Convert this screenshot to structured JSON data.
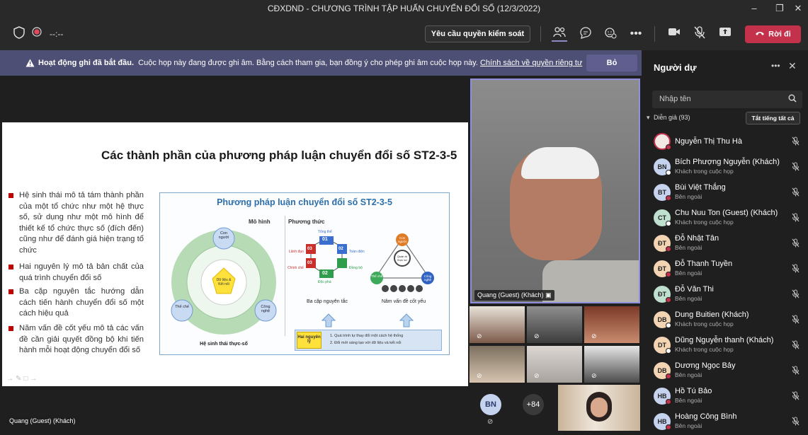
{
  "window": {
    "title": "CĐXDND - CHƯƠNG TRÌNH TẬP HUẤN CHUYỂN ĐỔI SỐ (12/3/2022)",
    "minimize_icon": "minimize-icon",
    "restore_icon": "restore-icon",
    "close_icon": "close-icon"
  },
  "toolbar": {
    "timer": "--:--",
    "request_control_label": "Yêu cầu quyền kiểm soát",
    "leave_label": "Rời đi"
  },
  "banner": {
    "bold": "Hoạt động ghi đã bắt đầu.",
    "message": "Cuộc họp này đang được ghi âm. Bằng cách tham gia, bạn đồng ý cho phép ghi âm cuộc họp này.",
    "link": "Chính sách về quyền riêng tư",
    "dismiss_label": "Bỏ"
  },
  "slide": {
    "title": "Các thành phần của phương pháp luận chuyển đổi số ST2-3-5",
    "bullets": [
      "Hệ sinh thái mô tả tám thành phần của một tổ chức như một hệ thực số, sử dụng như một mô hình để thiết kế tổ chức thực số (đích đến) cũng như để đánh giá hiện trạng tổ chức",
      "Hai nguyên lý mô tả bản chất của quá trình chuyển đổi số",
      "Ba cặp nguyên tắc hướng dẫn cách tiến hành chuyển đổi số một cách hiệu quả",
      "Năm vấn đề cốt yếu mô tả các vấn đề cần giải quyết đồng bộ khi tiến hành mỗi hoạt động chuyển đổi số"
    ],
    "diagram": {
      "title": "Phương pháp luận chuyển đổi số ST2-3-5",
      "col_model": "Mô hình",
      "col_method": "Phương thức",
      "ecosystem_label": "Hệ sinh thái thực-số",
      "center_label": "Dữ liệu & Kết nối",
      "node_top": "Con người",
      "node_left": "Thể chế",
      "node_right": "Công nghệ",
      "hex_numbers": [
        "01",
        "02",
        "02",
        "03",
        "03"
      ],
      "hex_labels": [
        "Tổng thể",
        "Toàn diện",
        "Đồng bộ",
        "Độc phá",
        "Chính chế",
        "Lãnh đạo"
      ],
      "pairs_label": "Ba cặp nguyên tắc",
      "tri_center": "Quản trị thực số",
      "tri_top": "Con người",
      "tri_left": "Thể chế",
      "tri_right": "Công nghệ",
      "issues_label": "Năm vấn đề cốt yếu",
      "principle_box": "Hai nguyên lý",
      "principles": [
        "1.   Quá trình tự thay đổi một cách hệ thống",
        "2.   Đổi mới sáng tạo với dữ liệu và kết nối"
      ]
    }
  },
  "speaker": {
    "name": "Quang (Guest) (Khách)"
  },
  "presenter_label": "Quang (Guest) (Khách)",
  "stage_avatar": {
    "initials": "BN",
    "overflow": "+84"
  },
  "panel": {
    "title": "Người dự",
    "search_placeholder": "Nhập tên",
    "section": "Diễn giả (93)",
    "mute_all": "Tắt tiếng tất cả",
    "people": [
      {
        "initials": "",
        "name": "Nguyễn Thị Thu Hà",
        "sub": "",
        "color": "#e8e0d8"
      },
      {
        "initials": "BN",
        "name": "Bích Phượng Nguyễn (Khách)",
        "sub": "Khách trong cuộc họp",
        "color": "#c6d3ef"
      },
      {
        "initials": "BT",
        "name": "Bùi Việt Thắng",
        "sub": "Bên ngoài",
        "color": "#c6d3ef"
      },
      {
        "initials": "CT",
        "name": "Chu Nuu Ton (Guest) (Khách)",
        "sub": "Khách trong cuộc họp",
        "color": "#bfe0cf"
      },
      {
        "initials": "ĐT",
        "name": "Đỗ Nhật Tân",
        "sub": "Bên ngoài",
        "color": "#f3d4b3"
      },
      {
        "initials": "ĐT",
        "name": "Đỗ Thanh Tuyền",
        "sub": "Bên ngoài",
        "color": "#f3d4b3"
      },
      {
        "initials": "ĐT",
        "name": "Đỗ Văn Thi",
        "sub": "Bên ngoài",
        "color": "#bfe0cf"
      },
      {
        "initials": "DB",
        "name": "Dung Buitien (Khách)",
        "sub": "Khách trong cuộc họp",
        "color": "#f3d4b3"
      },
      {
        "initials": "DT",
        "name": "Dũng Nguyễn thanh (Khách)",
        "sub": "Khách trong cuộc họp",
        "color": "#f3d4b3"
      },
      {
        "initials": "DB",
        "name": "Dương Ngọc Bảy",
        "sub": "Bên ngoài",
        "color": "#f3d4b3"
      },
      {
        "initials": "HB",
        "name": "Hồ Tú Bảo",
        "sub": "Bên ngoài",
        "color": "#c6d3ef"
      },
      {
        "initials": "HB",
        "name": "Hoàng Công Bình",
        "sub": "Bên ngoài",
        "color": "#c6d3ef"
      }
    ]
  }
}
